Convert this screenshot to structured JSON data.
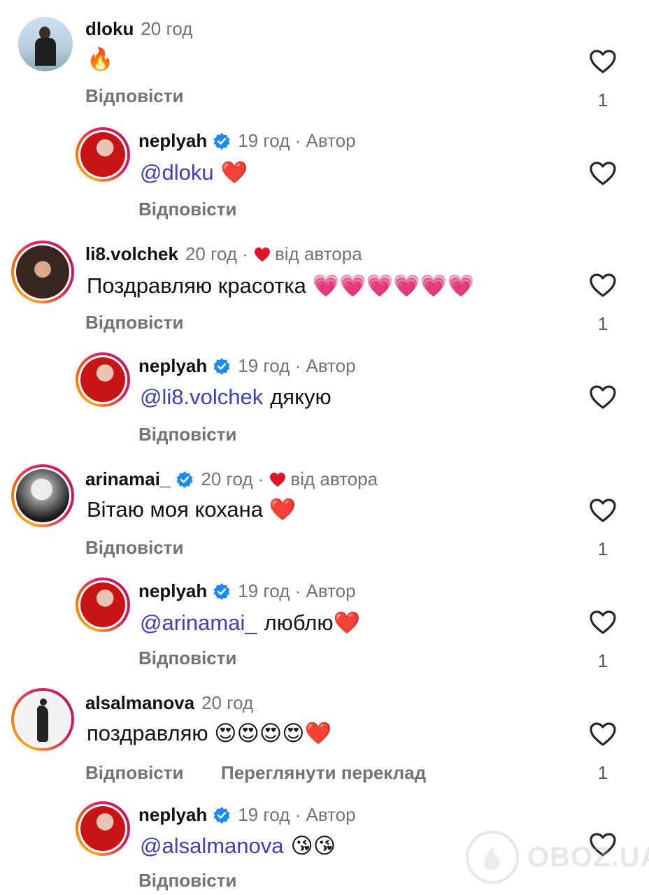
{
  "reply_label": "Відповісти",
  "comments": [
    {
      "username": "dloku",
      "time": "20 год",
      "text": "🔥",
      "likes": "1"
    },
    {
      "username": "neplyah",
      "time": "19 год · Автор",
      "mention": "@dloku",
      "text": "❤️",
      "likes": ""
    },
    {
      "username": "li8.volchek",
      "time": "20 год ·",
      "liked_by_author": "від автора",
      "text": "Поздравляю красотка 💗💗💗💗💗💗",
      "likes": "1"
    },
    {
      "username": "neplyah",
      "time": "19 год · Автор",
      "mention": "@li8.volchek",
      "text": "дякую",
      "likes": ""
    },
    {
      "username": "arinamai_",
      "time": "20 год ·",
      "liked_by_author": "від автора",
      "text": "Вітаю моя кохана ❤️",
      "likes": "1"
    },
    {
      "username": "neplyah",
      "time": "19 год · Автор",
      "mention": "@arinamai_",
      "text": "люблю❤️",
      "likes": "1"
    },
    {
      "username": "alsalmanova",
      "time": "20 год",
      "text": "поздравляю 😍😍😍😍❤️",
      "translate_label": "Переглянути переклад",
      "likes": "1"
    },
    {
      "username": "neplyah",
      "time": "19 год · Автор",
      "mention": "@alsalmanova",
      "text": "😘😘",
      "likes": ""
    }
  ],
  "watermark": "OBOZ.UA",
  "colors": {
    "mention": "#3b3fbf",
    "meta": "#737373",
    "verified": "#1d8cf0",
    "heart": "#e0142b",
    "pink_heart": "#ff3fa4"
  },
  "icons": [
    "heart-outline-icon",
    "verified-badge-icon",
    "heart-filled-icon"
  ]
}
